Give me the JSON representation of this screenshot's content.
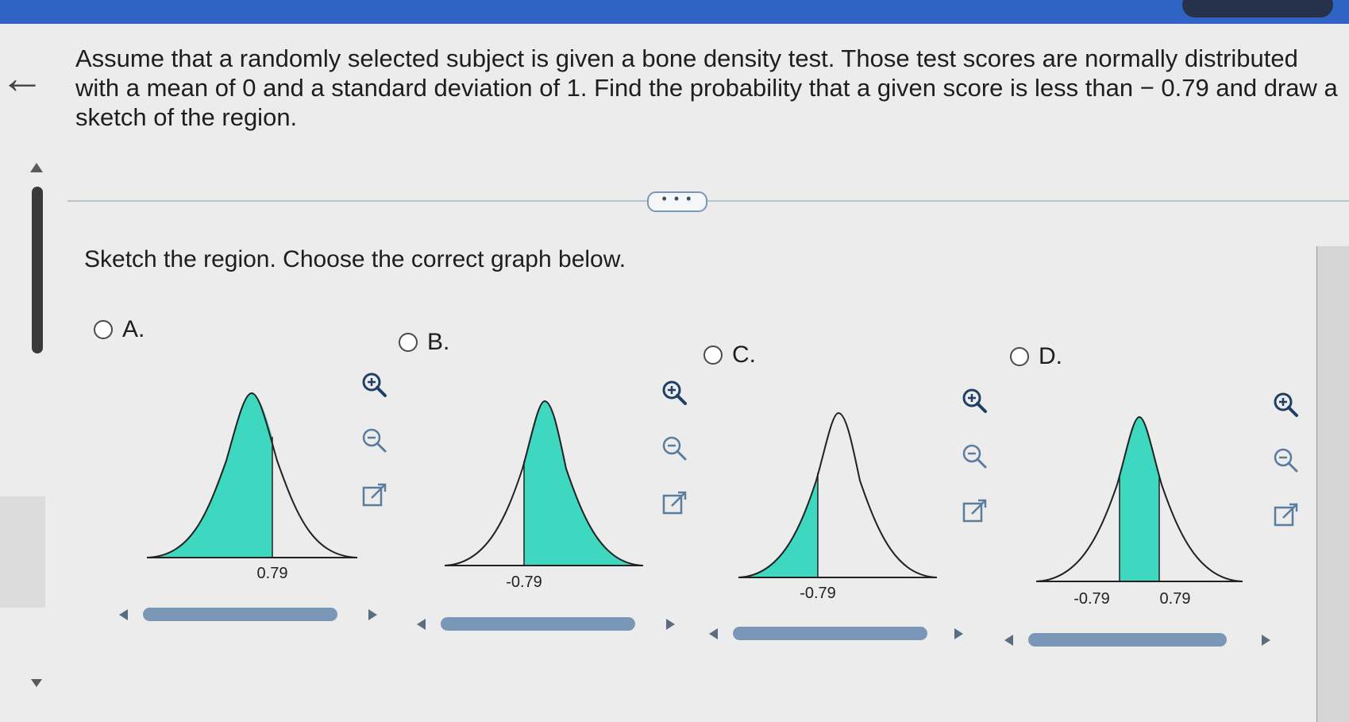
{
  "question": {
    "text": "Assume that a randomly selected subject is given a bone density test. Those test scores are normally distributed with a mean of 0 and a standard deviation of 1. Find the probability that a given score is less than − 0.79 and draw a sketch of the region."
  },
  "more_button": {
    "label": "• • •"
  },
  "prompt": "Sketch the region. Choose the correct graph below.",
  "options": [
    {
      "label": "A.",
      "tick_labels": [
        "0.79"
      ],
      "shaded": "left of 0.79"
    },
    {
      "label": "B.",
      "tick_labels": [
        "-0.79"
      ],
      "shaded": "right of -0.79"
    },
    {
      "label": "C.",
      "tick_labels": [
        "-0.79"
      ],
      "shaded": "left of -0.79"
    },
    {
      "label": "D.",
      "tick_labels": [
        "-0.79",
        "0.79"
      ],
      "shaded": "between -0.79 and 0.79"
    }
  ],
  "colors": {
    "shade": "#3ed8c0",
    "accent": "#2f63c4"
  },
  "icons": [
    "back-arrow-icon",
    "zoom-in-icon",
    "zoom-out-icon",
    "pop-out-icon"
  ]
}
